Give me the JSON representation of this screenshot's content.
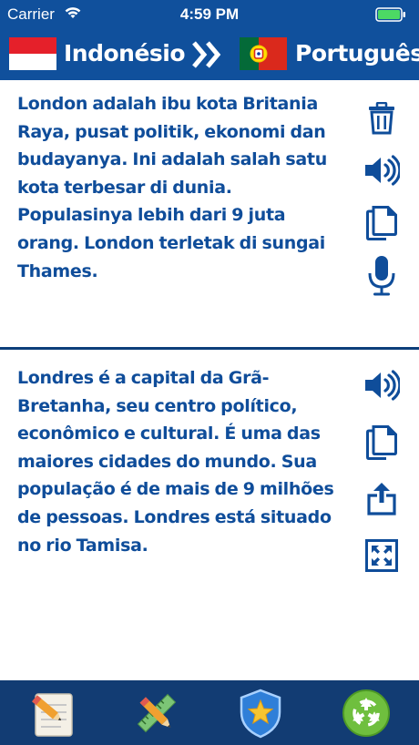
{
  "status_bar": {
    "carrier": "Carrier",
    "time": "4:59 PM",
    "icons": [
      "wifi-icon",
      "battery-icon"
    ]
  },
  "header": {
    "source_language": "Indonésio",
    "target_language": "Português",
    "source_flag": "indonesia-flag",
    "target_flag": "portugal-flag",
    "swap_icon": "double-chevron-right-icon"
  },
  "source_panel": {
    "text": "London adalah ibu kota Britania Raya, pusat politik, ekonomi dan budayanya. Ini adalah salah satu kota terbesar di dunia. Populasinya lebih dari 9 juta orang. London terletak di sungai Thames.",
    "actions": [
      "trash-icon",
      "speaker-icon",
      "copy-icon",
      "microphone-icon"
    ]
  },
  "translation_panel": {
    "text": "Londres é a capital da Grã-Bretanha, seu centro político, econômico e cultural. É uma das maiores cidades do mundo. Sua população é de mais de 9 milhões de pessoas. Londres está situado no rio Tamisa.",
    "actions": [
      "speaker-icon",
      "copy-icon",
      "share-icon",
      "fullscreen-icon"
    ]
  },
  "tab_bar": {
    "tabs": [
      "notepad-pencil-icon",
      "ruler-pencil-icon",
      "star-shield-icon",
      "recycle-icon"
    ]
  },
  "colors": {
    "header_blue": "#10509c",
    "text_blue": "#0f4d9a",
    "tab_bar_navy": "#123c73",
    "background": "#ffffff"
  }
}
